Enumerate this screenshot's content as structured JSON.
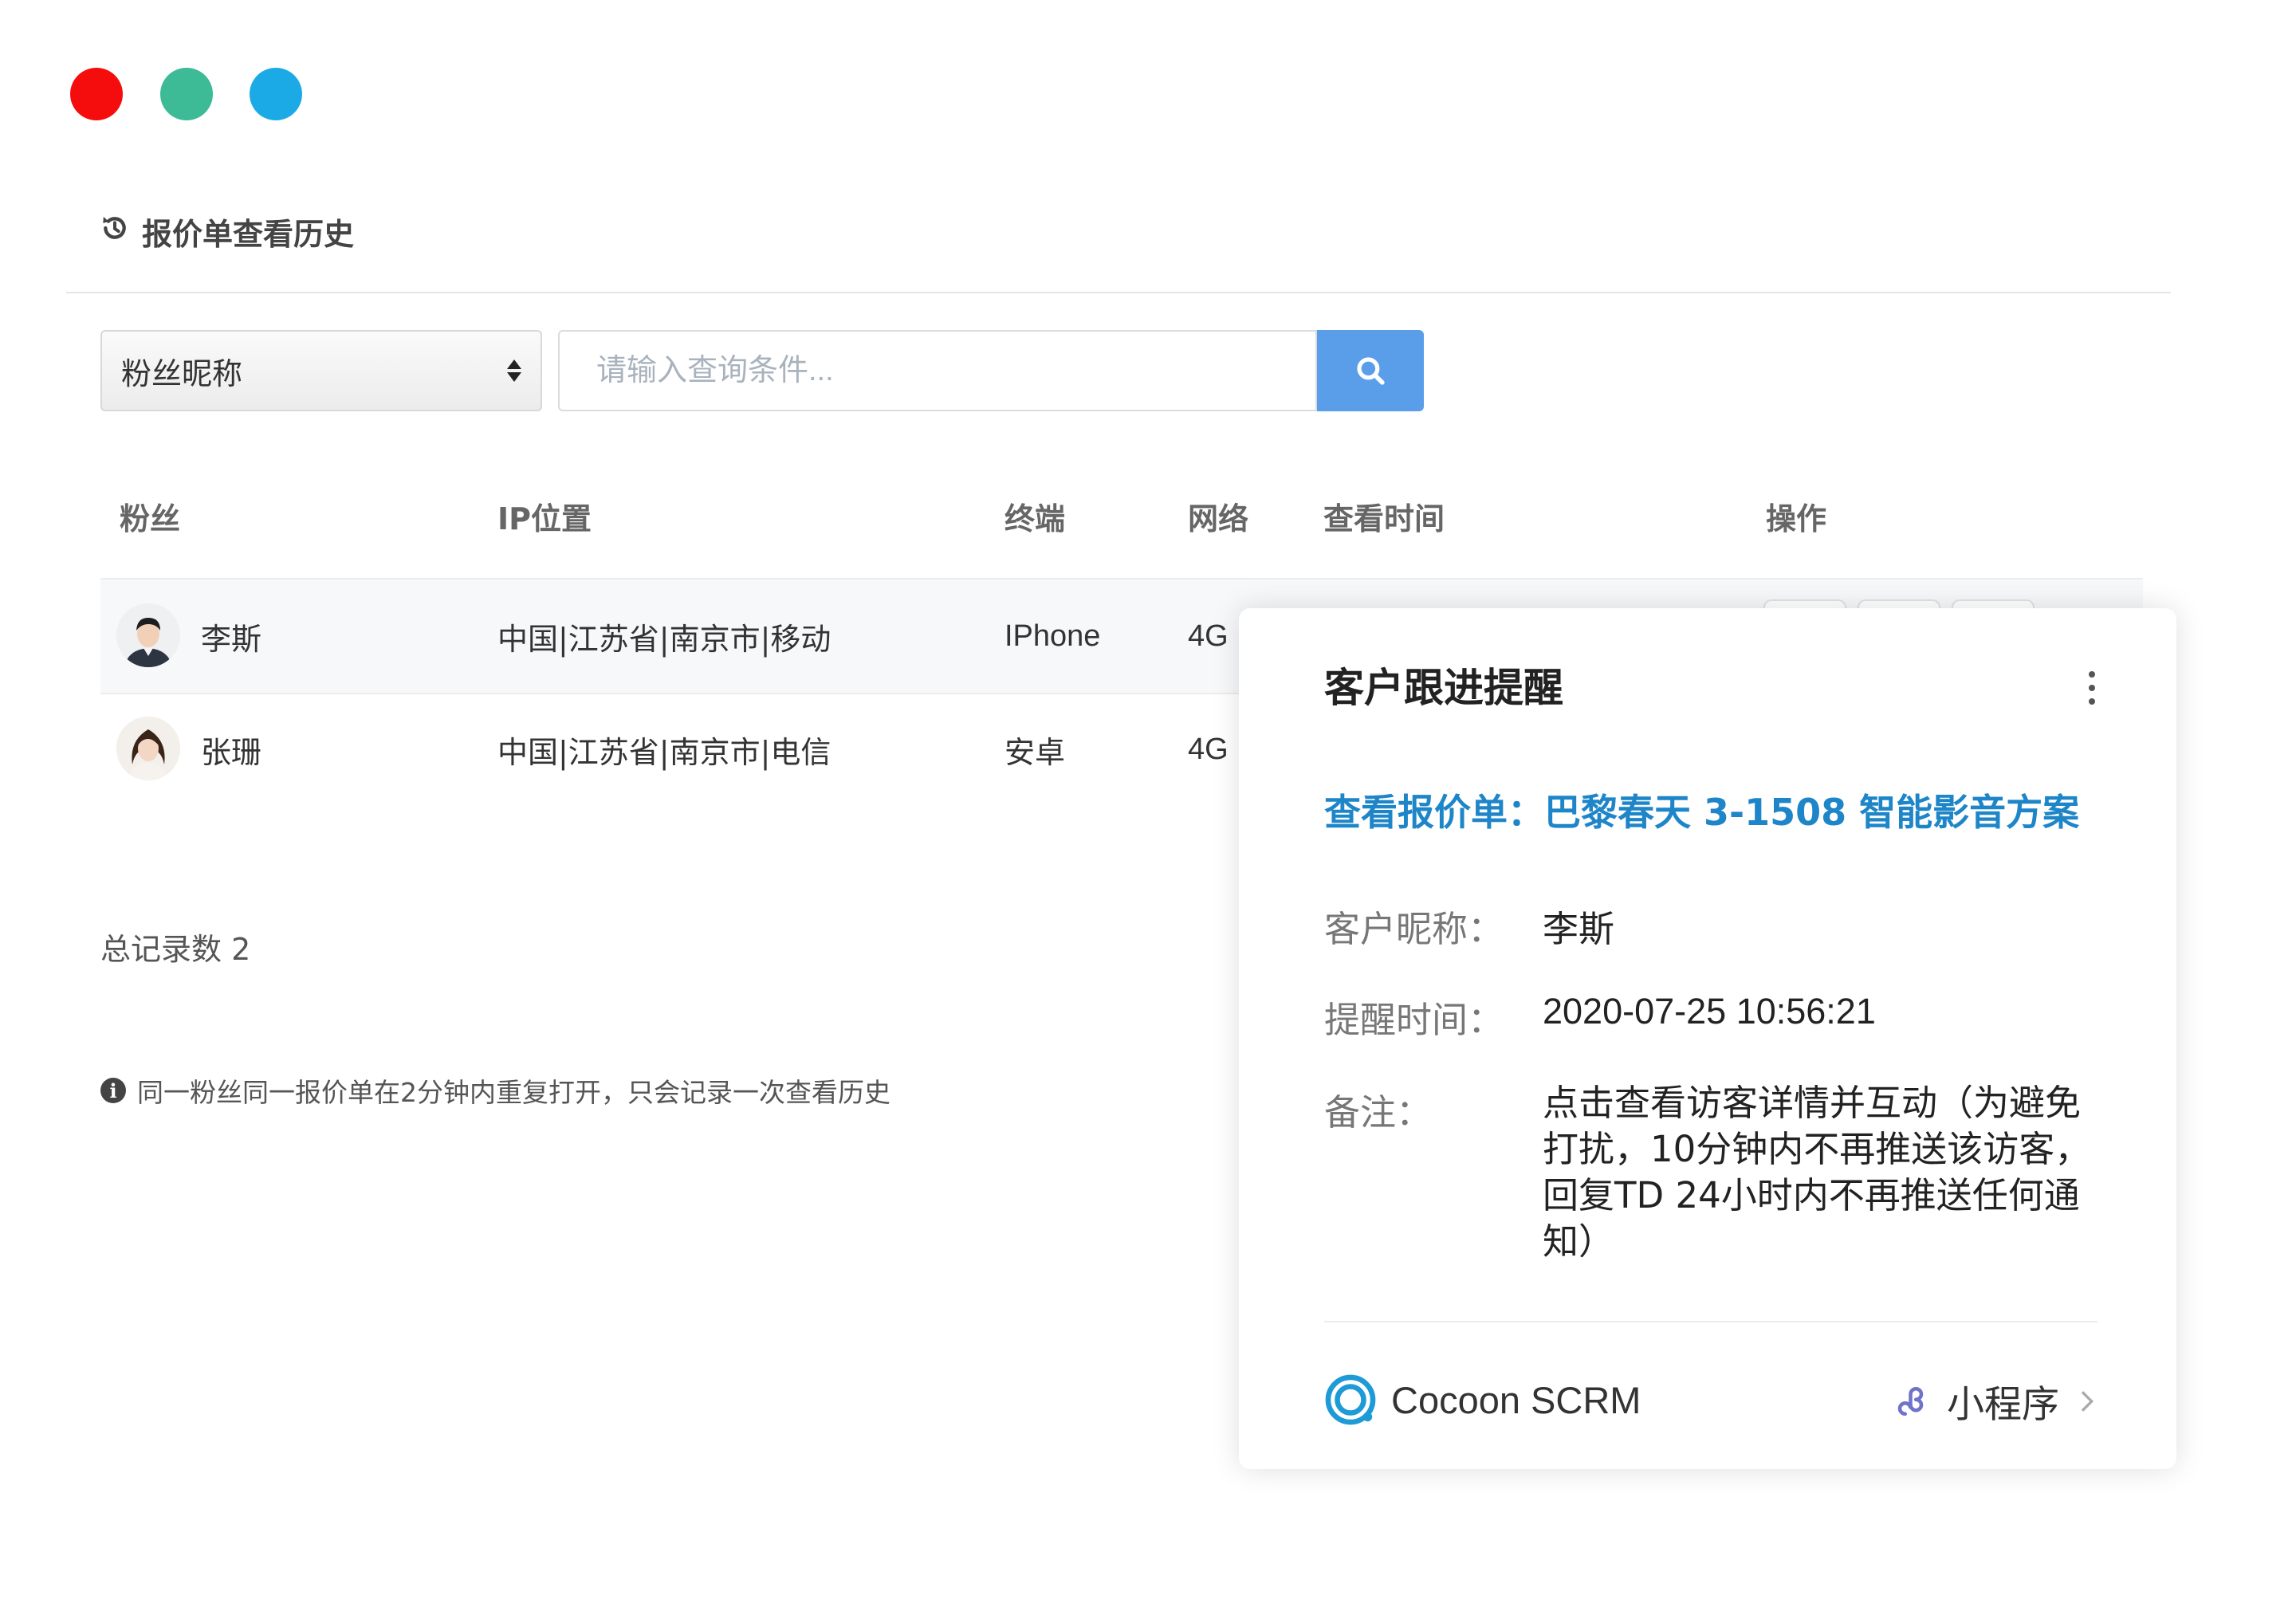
{
  "window": {
    "controls": [
      "close",
      "minimize",
      "maximize"
    ]
  },
  "page": {
    "title": "报价单查看历史"
  },
  "filter": {
    "field_selected": "粉丝昵称",
    "search_placeholder": "请输入查询条件..."
  },
  "table": {
    "columns": [
      "粉丝",
      "IP位置",
      "终端",
      "网络",
      "查看时间",
      "操作"
    ],
    "rows": [
      {
        "name": "李斯",
        "ip": "中国|江苏省|南京市|移动",
        "device": "IPhone",
        "network": "4G"
      },
      {
        "name": "张珊",
        "ip": "中国|江苏省|南京市|电信",
        "device": "安卓",
        "network": "4G"
      }
    ]
  },
  "summary": {
    "total": "总记录数 2",
    "note": "同一粉丝同一报价单在2分钟内重复打开，只会记录一次查看历史"
  },
  "card": {
    "title": "客户跟进提醒",
    "link": "查看报价单：巴黎春天 3-1508 智能影音方案",
    "nickname_label": "客户昵称：",
    "nickname": "李斯",
    "time_label": "提醒时间：",
    "time": "2020-07-25 10:56:21",
    "remark_label": "备注：",
    "remark": "点击查看访客详情并互动（为避免打扰，10分钟内不再推送该访客，回复TD 24小时内不再推送任何通知）",
    "brand": "Cocoon SCRM",
    "mini_program": "小程序"
  },
  "colors": {
    "accent": "#5a9eea",
    "link": "#1e86c8",
    "close": "#f50d0d",
    "minimize": "#3dba96",
    "maximize": "#1caae6"
  }
}
